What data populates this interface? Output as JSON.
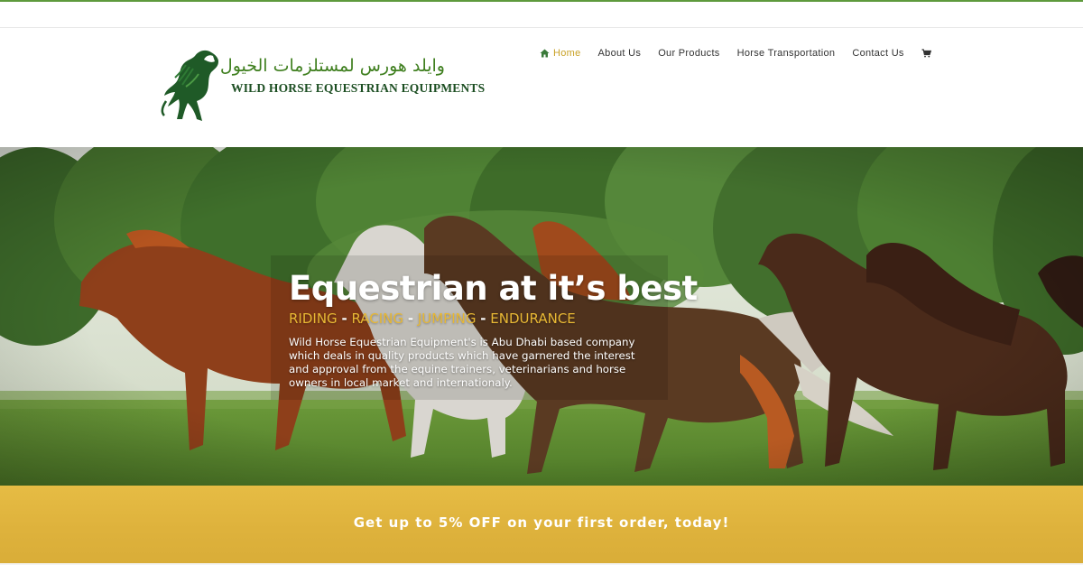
{
  "logo": {
    "arabic_text": "وايلد هورس لمستلزمات الخيول",
    "english_text": "WILD HORSE EQUESTRIAN EQUIPMENTS",
    "icon": "horse-logo-icon"
  },
  "nav": {
    "items": [
      {
        "label": "Home",
        "icon": "home-icon",
        "active": true
      },
      {
        "label": "About Us"
      },
      {
        "label": "Our Products"
      },
      {
        "label": "Horse Transportation"
      },
      {
        "label": "Contact Us"
      }
    ],
    "cart_icon": "cart-icon"
  },
  "hero": {
    "title": "Equestrian at it’s best",
    "disciplines": [
      "RIDING",
      "RACING",
      "JUMPING",
      "ENDURANCE"
    ],
    "separator": "-",
    "description": "Wild Horse Equestrian Equipment's is Abu Dhabi based company which deals in quality products which have garnered the interest and approval from the equine trainers, veterinarians and horse owners in local market and internationaly."
  },
  "promo": {
    "text": "Get up to 5% OFF on your first order, today!"
  },
  "colors": {
    "accent_gold": "#c9a227",
    "promo_gold": "#deb23c",
    "brand_green": "#3f7f1f",
    "topline_green": "#5e9a3c"
  }
}
